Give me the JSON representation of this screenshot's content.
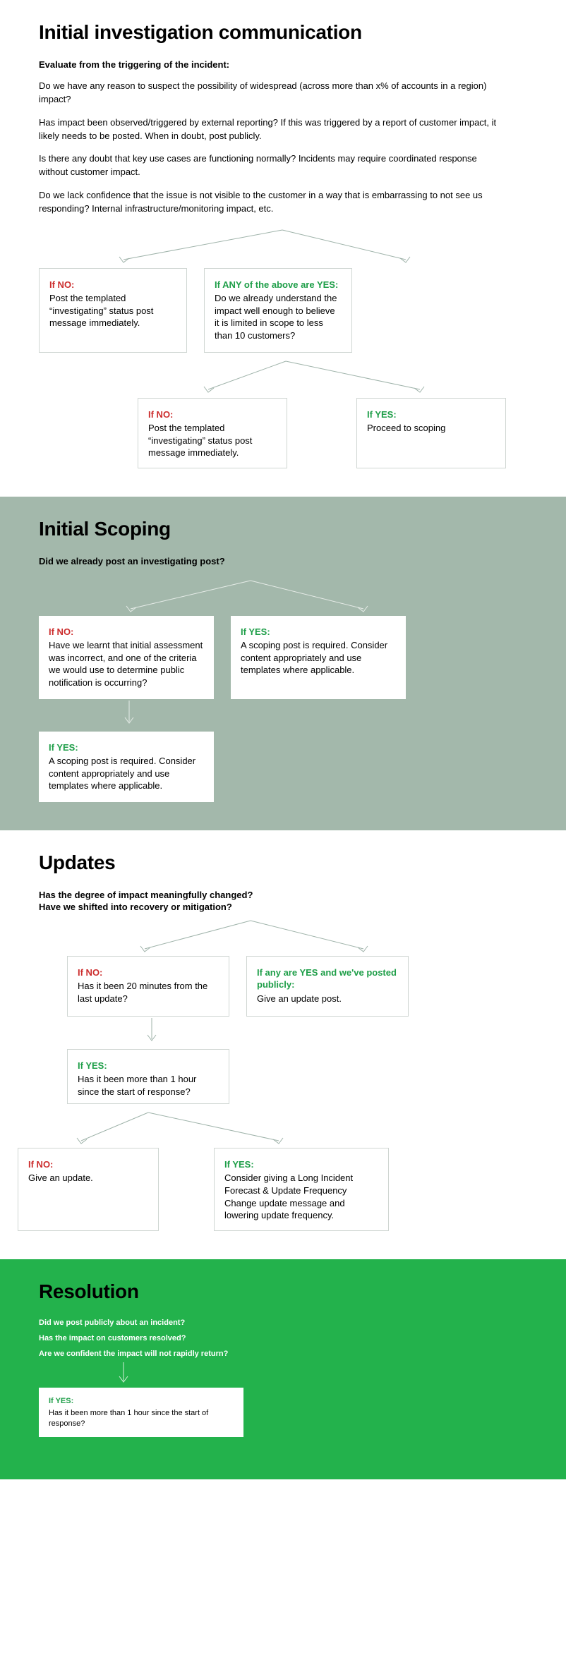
{
  "s1": {
    "title": "Initial investigation communication",
    "sub": "Evaluate from the triggering of the incident:",
    "p1": "Do we have any reason to suspect the possibility of widespread (across more than x% of accounts in a region) impact?",
    "p2": "Has impact been observed/triggered by external reporting? If this was triggered by a report of customer impact, it likely needs to be posted. When in doubt, post publicly.",
    "p3": "Is there any doubt that key use cases are functioning normally? Incidents may require coordinated response without customer impact.",
    "p4": "Do we lack confidence that the issue is not visible to the customer in a way that is embarrassing to not see us responding? Internal infrastructure/monitoring impact, etc.",
    "c1": {
      "cond": "If NO:",
      "body": "Post the templated “investigating” status post message immediately."
    },
    "c2": {
      "cond": "If ANY of the above are YES:",
      "body": "Do we already understand the impact well enough to believe it is limited in scope to less than 10 customers?"
    },
    "c3": {
      "cond": "If NO:",
      "body": "Post the templated “investigating” status post message immediately."
    },
    "c4": {
      "cond": "If YES:",
      "body": "Proceed to scoping"
    }
  },
  "s2": {
    "title": "Initial Scoping",
    "sub": "Did we already post an investigating post?",
    "c1": {
      "cond": "If NO:",
      "body": "Have we learnt that initial assessment was incorrect, and one of the criteria we would use to determine public notification is occurring?"
    },
    "c2": {
      "cond": "If YES:",
      "body": "A scoping post is required. Consider content appropriately and use templates where applicable."
    },
    "c3": {
      "cond": "If YES:",
      "body": "A scoping post is required. Consider content appropriately and use templates where applicable."
    }
  },
  "s3": {
    "title": "Updates",
    "q1": "Has the degree of impact meaningfully changed?",
    "q2": "Have we shifted into recovery or mitigation?",
    "c1": {
      "cond": "If NO:",
      "body": "Has it been 20 minutes from the last update?"
    },
    "c2": {
      "cond": "If any are YES and we've posted publicly:",
      "body": "Give an update post."
    },
    "c3": {
      "cond": "If YES:",
      "body": "Has it been more than 1 hour since the start of response?"
    },
    "c4": {
      "cond": "If NO:",
      "body": "Give an update."
    },
    "c5": {
      "cond": "If YES:",
      "body": "Consider giving a Long Incident Forecast & Update Frequency Change update message and lowering update frequency."
    }
  },
  "s4": {
    "title": "Resolution",
    "q1": "Did we post publicly about an incident?",
    "q2": "Has the impact on customers resolved?",
    "q3": "Are we confident the impact will not rapidly return?",
    "c1": {
      "cond": "If YES:",
      "body": "Has it been more than 1 hour since the start of response?"
    }
  }
}
